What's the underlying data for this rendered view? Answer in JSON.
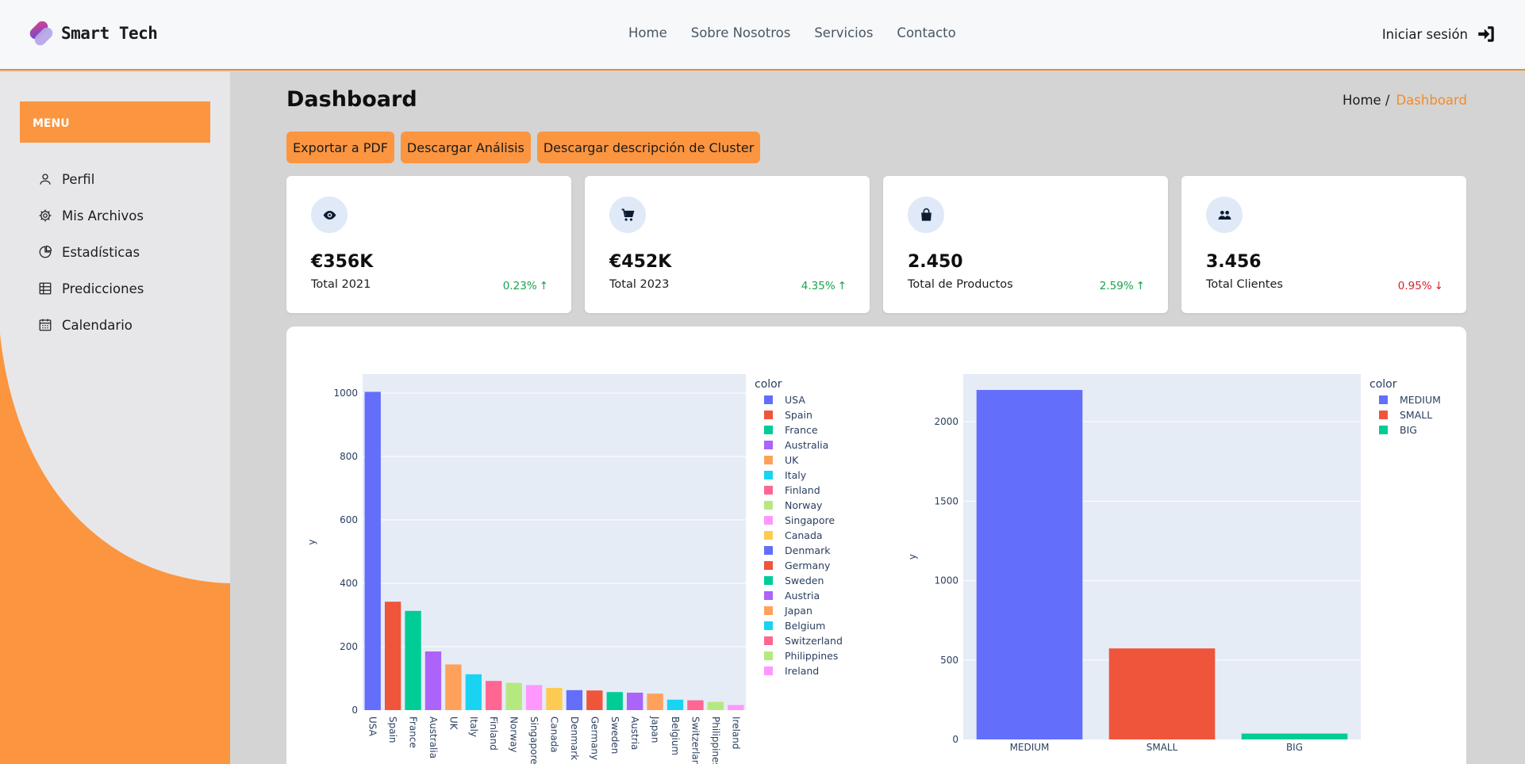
{
  "header": {
    "brand": "Smart Tech",
    "nav": [
      "Home",
      "Sobre Nosotros",
      "Servicios",
      "Contacto"
    ],
    "login": "Iniciar sesión"
  },
  "sidebar": {
    "menu_title": "MENU",
    "items": [
      {
        "label": "Perfil",
        "icon": "person-icon"
      },
      {
        "label": "Mis Archivos",
        "icon": "gear-icon"
      },
      {
        "label": "Estadísticas",
        "icon": "pie-chart-icon"
      },
      {
        "label": "Predicciones",
        "icon": "table-icon"
      },
      {
        "label": "Calendario",
        "icon": "calendar-icon"
      }
    ]
  },
  "main": {
    "title": "Dashboard",
    "breadcrumb": {
      "home": "Home /",
      "current": "Dashboard"
    },
    "buttons": {
      "export_pdf": "Exportar a PDF",
      "download_analysis": "Descargar Análisis",
      "download_cluster": "Descargar descripción de Cluster"
    }
  },
  "stats": [
    {
      "icon": "eye-icon",
      "value": "€356K",
      "label": "Total 2021",
      "delta": "0.23%",
      "trend": "up"
    },
    {
      "icon": "cart-icon",
      "value": "€452K",
      "label": "Total 2023",
      "delta": "4.35%",
      "trend": "up"
    },
    {
      "icon": "bag-icon",
      "value": "2.450",
      "label": "Total de Productos",
      "delta": "2.59%",
      "trend": "up"
    },
    {
      "icon": "people-icon",
      "value": "3.456",
      "label": "Total Clientes",
      "delta": "0.95%",
      "trend": "down"
    }
  ],
  "colors": {
    "accent": "#fb9540",
    "up": "#17a34a",
    "down": "#d8202a",
    "palette": [
      "#636efa",
      "#ef553b",
      "#00cc96",
      "#ab63fa",
      "#ffa15a",
      "#19d3f3",
      "#ff6692",
      "#b6e880",
      "#ff97ff",
      "#fecb52"
    ]
  },
  "chart_data": [
    {
      "type": "bar",
      "ylabel": "y",
      "legend_title": "color",
      "legend_position": "right",
      "ylim": [
        0,
        1060
      ],
      "yticks": [
        0,
        200,
        400,
        600,
        800,
        1000
      ],
      "categories": [
        "USA",
        "Spain",
        "France",
        "Australia",
        "UK",
        "Italy",
        "Finland",
        "Norway",
        "Singapore",
        "Canada",
        "Denmark",
        "Germany",
        "Sweden",
        "Austria",
        "Japan",
        "Belgium",
        "Switzerland",
        "Philippines",
        "Ireland"
      ],
      "values": [
        1004,
        342,
        313,
        185,
        144,
        113,
        92,
        86,
        79,
        70,
        63,
        62,
        57,
        55,
        52,
        33,
        31,
        26,
        16
      ]
    },
    {
      "type": "bar",
      "ylabel": "y",
      "legend_title": "color",
      "legend_position": "right",
      "ylim": [
        0,
        2300
      ],
      "yticks": [
        0,
        500,
        1000,
        1500,
        2000
      ],
      "categories": [
        "MEDIUM",
        "SMALL",
        "BIG"
      ],
      "values": [
        2200,
        573,
        37
      ]
    }
  ]
}
